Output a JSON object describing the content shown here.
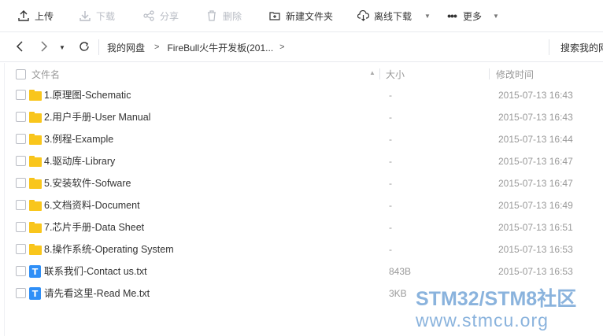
{
  "toolbar": {
    "upload": "上传",
    "download": "下载",
    "share": "分享",
    "delete": "删除",
    "new_folder": "新建文件夹",
    "offline_download": "离线下载",
    "more": "更多"
  },
  "nav": {
    "breadcrumbs": [
      "我的网盘",
      "FireBull火牛开发板(201..."
    ],
    "search_placeholder": "搜索我的网"
  },
  "columns": {
    "name": "文件名",
    "size": "大小",
    "modified": "修改时间"
  },
  "files": [
    {
      "name": "1.原理图-Schematic",
      "size": "-",
      "modified": "2015-07-13 16:43",
      "type": "folder-icon"
    },
    {
      "name": "2.用户手册-User Manual",
      "size": "-",
      "modified": "2015-07-13 16:43",
      "type": "folder-icon"
    },
    {
      "name": "3.例程-Example",
      "size": "-",
      "modified": "2015-07-13 16:44",
      "type": "folder-icon"
    },
    {
      "name": "4.驱动库-Library",
      "size": "-",
      "modified": "2015-07-13 16:47",
      "type": "folder-icon"
    },
    {
      "name": "5.安装软件-Sofware",
      "size": "-",
      "modified": "2015-07-13 16:47",
      "type": "folder-icon"
    },
    {
      "name": "6.文档资料-Document",
      "size": "-",
      "modified": "2015-07-13 16:49",
      "type": "folder-icon"
    },
    {
      "name": "7.芯片手册-Data Sheet",
      "size": "-",
      "modified": "2015-07-13 16:51",
      "type": "folder-icon"
    },
    {
      "name": "8.操作系统-Operating System",
      "size": "-",
      "modified": "2015-07-13 16:53",
      "type": "folder-icon"
    },
    {
      "name": "联系我们-Contact us.txt",
      "size": "843B",
      "modified": "2015-07-13 16:53",
      "type": "txt-file-icon"
    },
    {
      "name": "请先看这里-Read Me.txt",
      "size": "3KB",
      "modified": "",
      "type": "txt-file-icon"
    }
  ],
  "watermark": {
    "line1": "STM32/STM8社区",
    "line2": "www.stmcu.org"
  },
  "colors": {
    "folder": "#f9c61c",
    "txt_icon": "#2f8ff7",
    "watermark": "#8ab3dd"
  }
}
